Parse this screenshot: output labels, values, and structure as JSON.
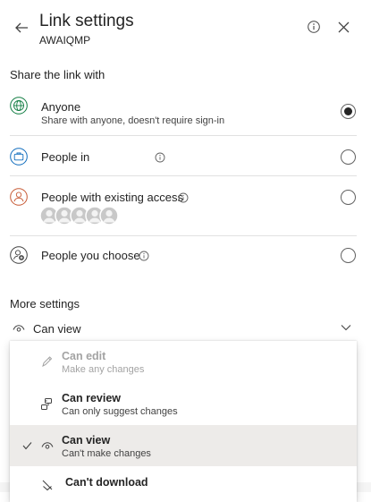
{
  "header": {
    "title": "Link settings",
    "subtitle": "AWAIQMP"
  },
  "share": {
    "heading": "Share the link with",
    "options": [
      {
        "label": "Anyone",
        "sublabel": "Share with anyone, doesn't require sign-in",
        "icon": "globe-icon",
        "selected": true
      },
      {
        "label": "People in",
        "icon": "briefcase-icon",
        "selected": false
      },
      {
        "label": "People with existing access",
        "icon": "person-icon",
        "selected": false
      },
      {
        "label": "People you choose",
        "icon": "person-add-icon",
        "selected": false
      }
    ]
  },
  "more": {
    "heading": "More settings",
    "permission_value": "Can view"
  },
  "menu": {
    "items": [
      {
        "title": "Can edit",
        "sub": "Make any changes",
        "icon": "pencil-icon",
        "disabled": true
      },
      {
        "title": "Can review",
        "sub": "Can only suggest changes",
        "icon": "review-icon",
        "disabled": false
      },
      {
        "title": "Can view",
        "sub": "Can't make changes",
        "icon": "eye-icon",
        "selected": true
      },
      {
        "title": "Can't download",
        "icon": "no-download-icon",
        "disabled": false
      }
    ]
  },
  "colors": {
    "globe": "#107c41",
    "briefcase": "#0f6cbd",
    "person": "#c75a35",
    "selected_bg": "#edebe9"
  }
}
